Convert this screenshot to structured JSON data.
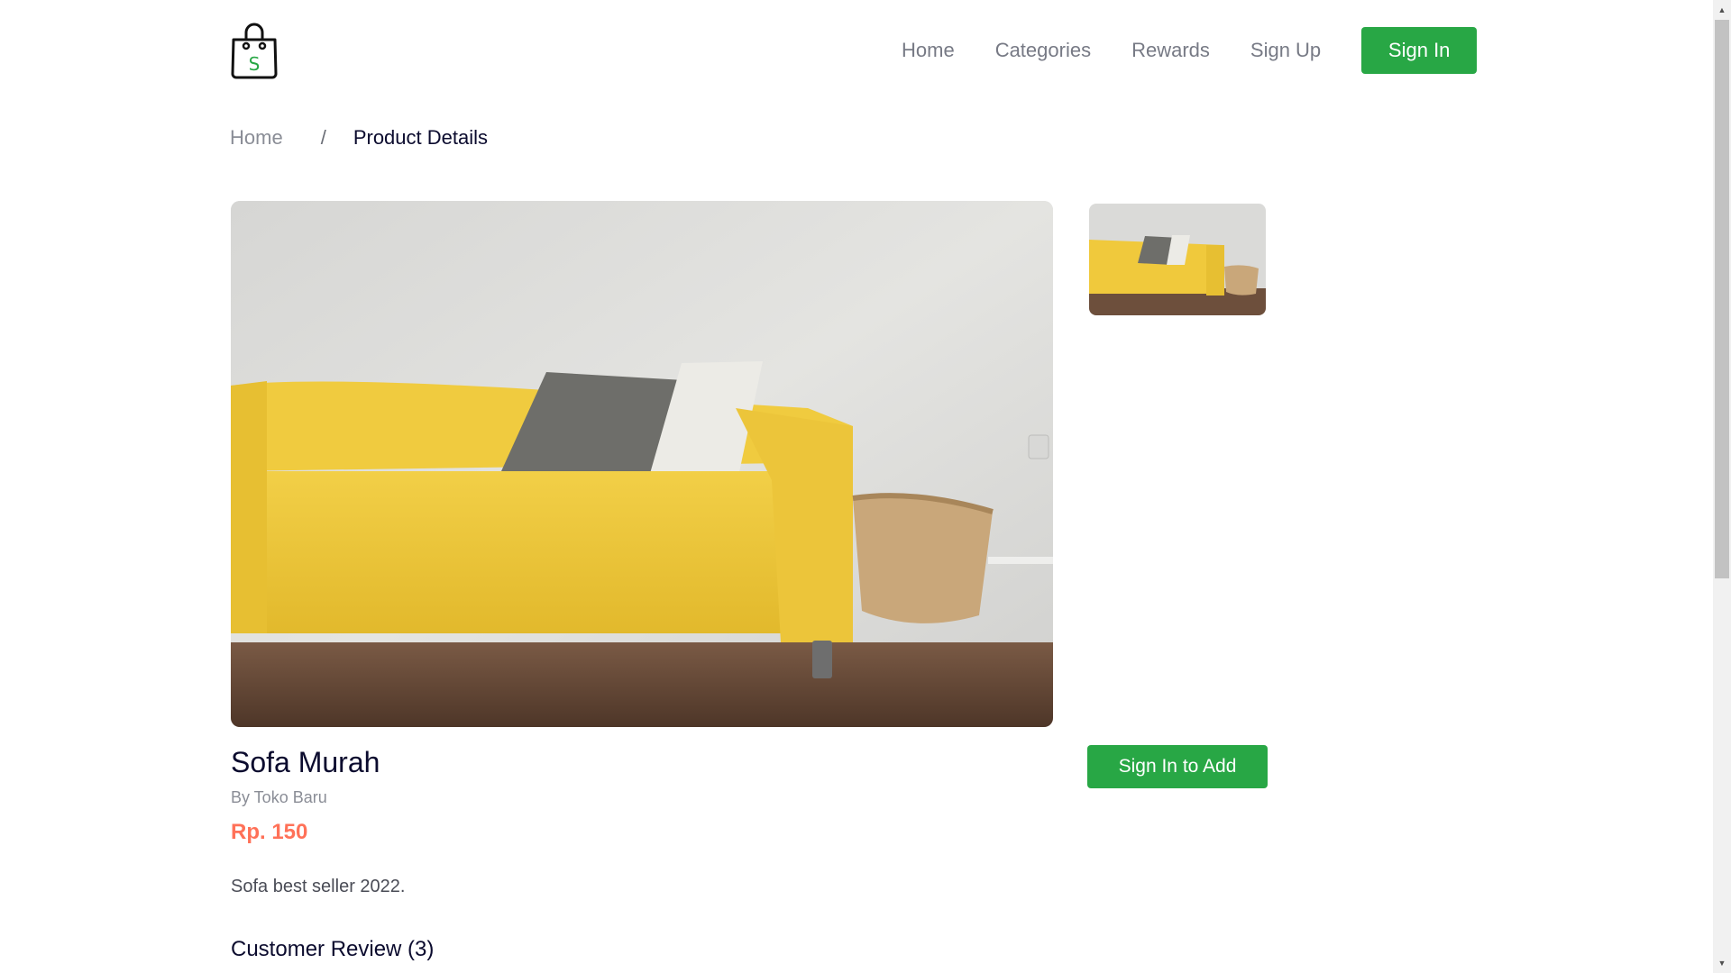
{
  "header": {
    "logo_letter": "S",
    "nav": [
      {
        "label": "Home"
      },
      {
        "label": "Categories"
      },
      {
        "label": "Rewards"
      },
      {
        "label": "Sign Up"
      }
    ],
    "signin_label": "Sign In"
  },
  "breadcrumb": {
    "home": "Home",
    "separator": "/",
    "current": "Product Details"
  },
  "product": {
    "name": "Sofa Murah",
    "seller": "By Toko Baru",
    "price": "Rp. 150",
    "description": "Sofa best seller 2022.",
    "add_button": "Sign In to Add",
    "reviews_heading": "Customer Review (3)"
  },
  "colors": {
    "brand_green": "#28a745",
    "price_red": "#ff7158",
    "text_dark": "#0b0b2e",
    "text_muted": "#8a8d96"
  },
  "icons": {
    "logo": "shopping-bag-icon",
    "scroll_up": "arrow-up-icon",
    "scroll_down": "arrow-down-icon"
  }
}
